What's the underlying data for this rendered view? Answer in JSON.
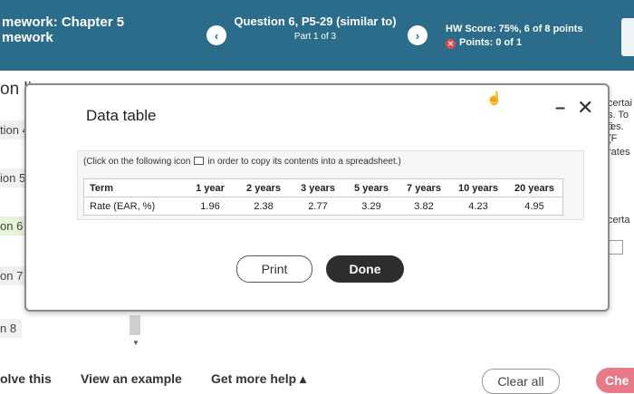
{
  "header": {
    "title_line1": "mework: Chapter 5",
    "title_line2": "mework",
    "prev_symbol": "‹",
    "next_symbol": "›",
    "question_title": "Question 6, P5-29 (similar to)",
    "question_part": "Part 1 of 3",
    "hw_score": "HW Score: 75%, 6 of 8 points",
    "points": "Points: 0 of 1"
  },
  "sidebar": {
    "heading": "on li",
    "items": [
      {
        "label": "tion 4"
      },
      {
        "label": "ion 5"
      },
      {
        "label": "on 6"
      },
      {
        "label": "on 7"
      },
      {
        "label": "n 8"
      }
    ]
  },
  "right_text": {
    "line1": "certai",
    "line2": "s. To fi",
    "line3": "tes. (F",
    "line4": "rates",
    "line5": "certa"
  },
  "modal": {
    "title": "Data table",
    "hint_before": "(Click on the following icon",
    "hint_after": "in order to copy its contents into a spreadsheet.)",
    "table": {
      "headers": [
        "Term",
        "1 year",
        "2 years",
        "3 years",
        "5 years",
        "7 years",
        "10 years",
        "20 years"
      ],
      "row": [
        "Rate (EAR, %)",
        "1.96",
        "2.38",
        "2.77",
        "3.29",
        "3.82",
        "4.23",
        "4.95"
      ]
    },
    "print_label": "Print",
    "done_label": "Done"
  },
  "bottom": {
    "solve_label": "olve this",
    "example_label": "View an example",
    "help_label": "Get more help ▴",
    "clear_label": "Clear all",
    "check_label": "Che"
  },
  "colors": {
    "header_bg": "#2b6c8a",
    "done_bg": "#2d2d2d",
    "check_bg": "#e77a86"
  }
}
